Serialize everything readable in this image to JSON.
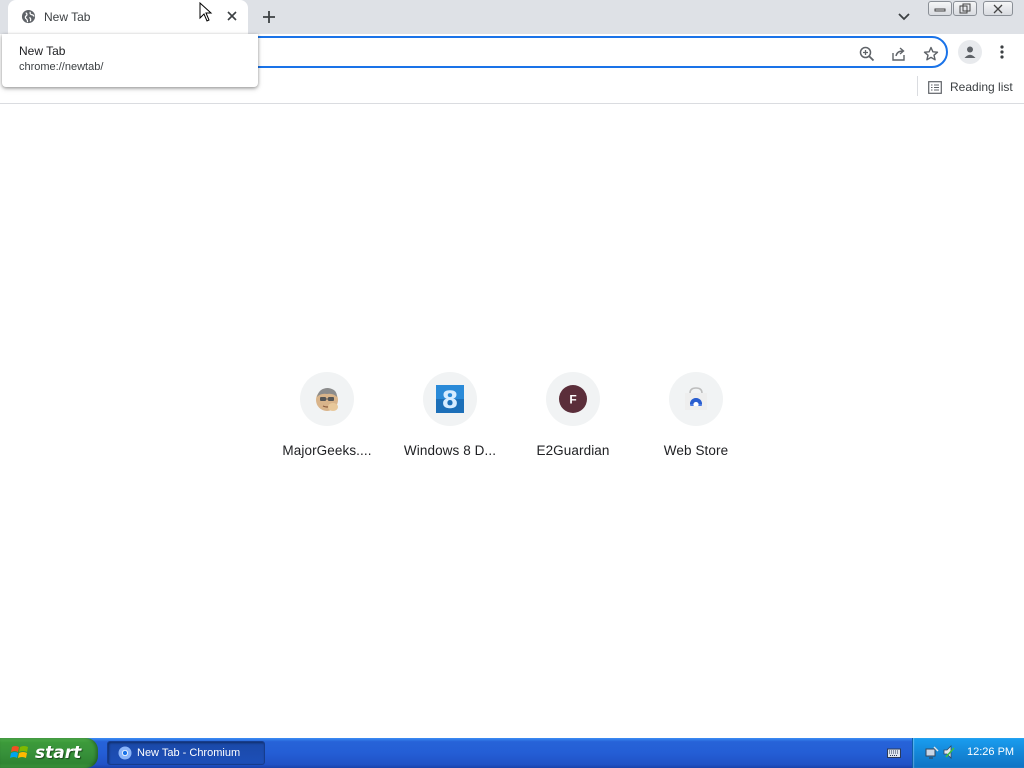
{
  "tab": {
    "title": "New Tab",
    "favicon": "globe-icon"
  },
  "hover_card": {
    "title": "New Tab",
    "url": "chrome://newtab/"
  },
  "bookmarks_bar": {
    "reading_list_label": "Reading list"
  },
  "shortcuts": [
    {
      "label": "MajorGeeks....",
      "icon": "majorgeeks-icon"
    },
    {
      "label": "Windows 8 D...",
      "icon": "windows8-icon"
    },
    {
      "label": "E2Guardian",
      "icon": "letter-f-icon",
      "letter": "F"
    },
    {
      "label": "Web Store",
      "icon": "webstore-icon"
    }
  ],
  "taskbar": {
    "start_label": "start",
    "task_label": "New Tab - Chromium",
    "clock": "12:26 PM"
  },
  "colors": {
    "accent": "#1a73e8",
    "tabstrip": "#dee1e6",
    "e2guardian_icon": "#5b2e3a"
  }
}
